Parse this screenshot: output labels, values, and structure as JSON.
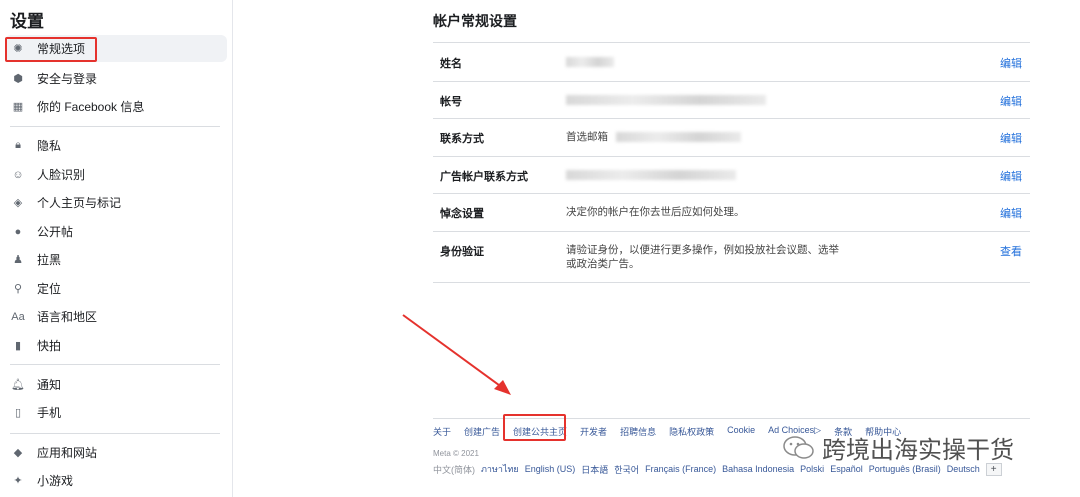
{
  "sidebar": {
    "title": "设置",
    "groups": [
      [
        {
          "label": "常规选项",
          "icon": "gear-icon"
        },
        {
          "label": "安全与登录",
          "icon": "shield-icon"
        },
        {
          "label": "你的 Facebook 信息",
          "icon": "grid-icon"
        }
      ],
      [
        {
          "label": "隐私",
          "icon": "lock-icon"
        },
        {
          "label": "人脸识别",
          "icon": "face-icon"
        },
        {
          "label": "个人主页与标记",
          "icon": "tag-icon"
        },
        {
          "label": "公开帖",
          "icon": "globe-icon"
        },
        {
          "label": "拉黑",
          "icon": "block-user-icon"
        },
        {
          "label": "定位",
          "icon": "location-icon"
        },
        {
          "label": "语言和地区",
          "icon": "language-icon"
        },
        {
          "label": "快拍",
          "icon": "stories-icon"
        }
      ],
      [
        {
          "label": "通知",
          "icon": "bell-icon"
        },
        {
          "label": "手机",
          "icon": "phone-icon"
        }
      ],
      [
        {
          "label": "应用和网站",
          "icon": "apps-icon"
        },
        {
          "label": "小游戏",
          "icon": "game-icon"
        }
      ]
    ]
  },
  "main": {
    "title": "帐户常规设置",
    "rows": [
      {
        "label": "姓名",
        "value": "",
        "action": "编辑"
      },
      {
        "label": "帐号",
        "value": "",
        "action": "编辑"
      },
      {
        "label": "联系方式",
        "value": "首选邮箱",
        "action": "编辑"
      },
      {
        "label": "广告帐户联系方式",
        "value": "",
        "action": "编辑"
      },
      {
        "label": "悼念设置",
        "value": "决定你的帐户在你去世后应如何处理。",
        "action": "编辑"
      },
      {
        "label": "身份验证",
        "value": "请验证身份，以便进行更多操作，例如投放社会议题、选举或政治类广告。",
        "action": "查看"
      }
    ]
  },
  "footer": {
    "links": [
      "关于",
      "创建广告",
      "创建公共主页",
      "开发者",
      "招聘信息",
      "隐私权政策",
      "Cookie",
      "Ad Choices▷",
      "条款",
      "帮助中心"
    ],
    "copyright": "Meta © 2021",
    "languages": [
      "中文(简体)",
      "ภาษาไทย",
      "English (US)",
      "日本語",
      "한국어",
      "Français (France)",
      "Bahasa Indonesia",
      "Polski",
      "Español",
      "Português (Brasil)",
      "Deutsch"
    ],
    "more": "+"
  },
  "watermark": "跨境出海实操干货",
  "colors": {
    "link": "#216fdb",
    "highlight": "#e5322d"
  }
}
